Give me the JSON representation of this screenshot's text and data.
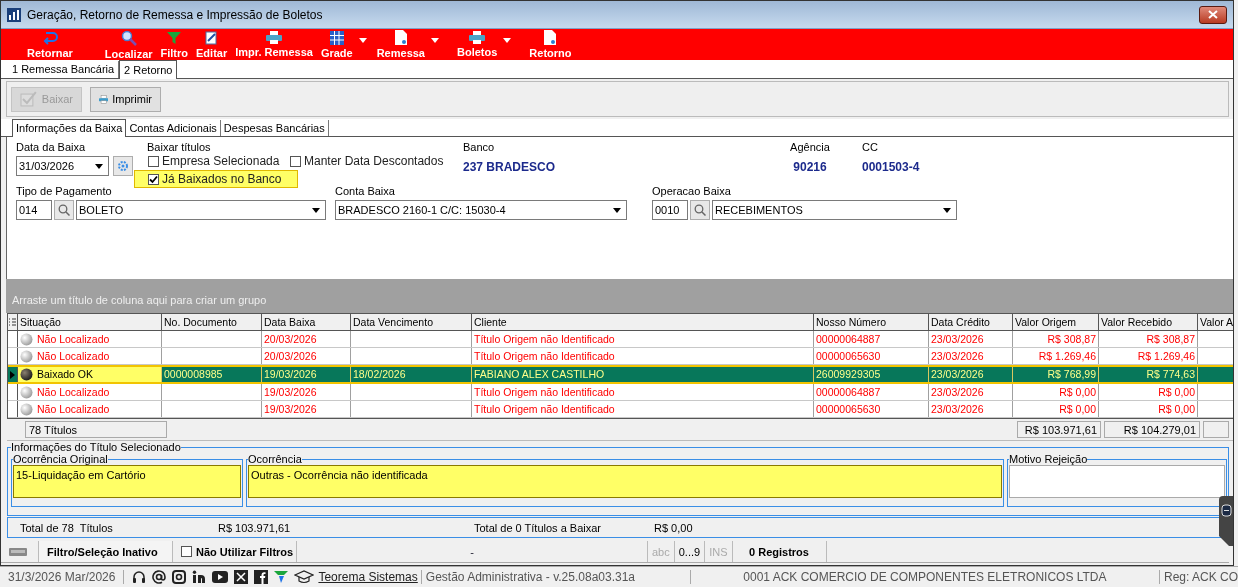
{
  "window": {
    "title": "Geração, Retorno de Remessa e Impressão de Boletos"
  },
  "toolbar": [
    {
      "label": "Retornar",
      "kind": "back",
      "dropdown": false
    },
    {
      "label": "Localizar",
      "kind": "search",
      "dropdown": false
    },
    {
      "label": "Filtro",
      "kind": "filter",
      "dropdown": false
    },
    {
      "label": "Editar",
      "kind": "edit",
      "dropdown": false
    },
    {
      "label": "Impr. Remessa",
      "kind": "print",
      "dropdown": false
    },
    {
      "label": "Grade",
      "kind": "grid",
      "dropdown": true
    },
    {
      "label": "Remessa",
      "kind": "document",
      "dropdown": true
    },
    {
      "label": "Boletos",
      "kind": "print",
      "dropdown": true
    },
    {
      "label": "Retorno",
      "kind": "document",
      "dropdown": false
    }
  ],
  "tabs": [
    {
      "label": "1 Remessa Bancária",
      "selected": false
    },
    {
      "label": "2 Retorno",
      "selected": true
    }
  ],
  "actions": [
    {
      "label": "Baixar",
      "kind": "check",
      "disabled": true
    },
    {
      "label": "Imprimir",
      "kind": "print",
      "disabled": false
    }
  ],
  "subtabs": [
    {
      "label": "Informações da Baixa",
      "selected": true
    },
    {
      "label": "Contas Adicionais",
      "selected": false
    },
    {
      "label": "Despesas Bancárias",
      "selected": false
    }
  ],
  "form": {
    "date": {
      "label": "Data da Baixa",
      "value": "31/03/2026"
    },
    "baixar": {
      "label": "Baixar títulos",
      "options": [
        {
          "label": "Empresa Selecionada",
          "checked": false,
          "highlighted": false
        },
        {
          "label": "Manter Data Descontados",
          "checked": false,
          "highlighted": false
        },
        {
          "label": "Já Baixados no Banco",
          "checked": true,
          "highlighted": true
        }
      ]
    },
    "banco": {
      "label": "Banco",
      "value": "237 BRADESCO"
    },
    "agencia": {
      "label": "Agência",
      "value": "90216"
    },
    "cc": {
      "label": "CC",
      "value": "0001503-4"
    },
    "tipo_pagamento": {
      "label": "Tipo de Pagamento",
      "code": "014",
      "value": "BOLETO"
    },
    "conta_baixa": {
      "label": "Conta Baixa",
      "value": "BRADESCO 2160-1 C/C: 15030-4"
    },
    "operacao_baixa": {
      "label": "Operacao Baixa",
      "code": "0010",
      "value": "RECEBIMENTOS"
    }
  },
  "group_hint": "Arraste um título de coluna aqui para criar um grupo",
  "grid": {
    "columns": [
      "Situação",
      "No. Documento",
      "Data Baixa",
      "Data Vencimento",
      "Cliente",
      "Nosso Número",
      "Data Crédito",
      "Valor Origem",
      "Valor Recebido",
      "Valor A"
    ],
    "rows": [
      {
        "kind": "not_found",
        "selected": false,
        "cells": [
          "Não Localizado",
          "",
          "20/03/2026",
          "",
          "Título Origem não Identificado",
          "00000064887",
          "23/03/2026",
          "R$ 308,87",
          "R$ 308,87"
        ]
      },
      {
        "kind": "not_found",
        "selected": false,
        "cells": [
          "Não Localizado",
          "",
          "20/03/2026",
          "",
          "Título Origem não Identificado",
          "00000065630",
          "23/03/2026",
          "R$ 1.269,46",
          "R$ 1.269,46"
        ]
      },
      {
        "kind": "ok",
        "selected": true,
        "cells": [
          "Baixado OK",
          "0000008985",
          "19/03/2026",
          "18/02/2026",
          "FABIANO ALEX CASTILHO",
          "26009929305",
          "23/03/2026",
          "R$ 768,99",
          "R$ 774,63"
        ]
      },
      {
        "kind": "not_found",
        "selected": false,
        "cells": [
          "Não Localizado",
          "",
          "19/03/2026",
          "",
          "Título Origem não Identificado",
          "00000064887",
          "23/03/2026",
          "R$ 0,00",
          "R$ 0,00"
        ]
      },
      {
        "kind": "not_found",
        "selected": false,
        "cells": [
          "Não Localizado",
          "",
          "19/03/2026",
          "",
          "Título Origem não Identificado",
          "00000065630",
          "23/03/2026",
          "R$ 0,00",
          "R$ 0,00"
        ]
      }
    ],
    "footer": {
      "count": "78 Títulos",
      "valor_origem": "R$ 103.971,61",
      "valor_recebido": "R$ 104.279,01"
    }
  },
  "selected_info": {
    "title": "Informações do Título Selecionado",
    "ocorrencia_original": {
      "label": "Ocorrência Original",
      "value": "15-Liquidação em Cartório"
    },
    "ocorrencia": {
      "label": "Ocorrência",
      "value": "Outras - Ocorrência não identificada"
    },
    "motivo_rejeicao": {
      "label": "Motivo Rejeição"
    }
  },
  "totals": {
    "titulos": "Total de 78  Títulos",
    "valor": "R$ 103.971,61",
    "a_baixar": "Total de 0 Títulos a Baixar",
    "valor_a_baixar": "R$ 0,00"
  },
  "status_bar": {
    "filter": "Filtro/Seleção Inativo",
    "no_filters": {
      "label": "Não Utilizar Filtros",
      "checked": false
    },
    "info": "-",
    "indicators": [
      {
        "label": "abc",
        "on": false
      },
      {
        "label": "0...9",
        "on": true
      },
      {
        "label": "INS",
        "on": false
      }
    ],
    "records": "0 Registros"
  },
  "bottom_bar": {
    "date": "31/3/2026 Mar/2026",
    "link": "Teorema Sistemas",
    "app": "Gestão Administrativa - v.25.08a03.31a",
    "company": "0001 ACK COMERCIO DE COMPONENTES ELETRONICOS LTDA",
    "reg": "Reg: ACK CO"
  }
}
